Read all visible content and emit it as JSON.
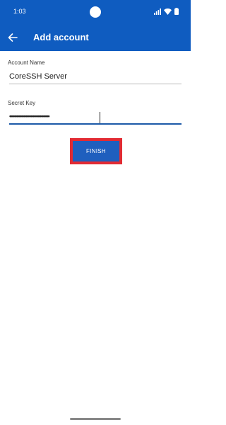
{
  "status_bar": {
    "time": "1:03"
  },
  "app_bar": {
    "title": "Add account",
    "back_icon": "arrow-left-icon"
  },
  "form": {
    "account_name": {
      "label": "Account Name",
      "value": "CoreSSH Server"
    },
    "secret_key": {
      "label": "Secret Key",
      "value": "••••••••••••••••••••••••••••••••••"
    }
  },
  "finish_button": {
    "label": "FINISH",
    "highlight_color": "#e22b33"
  },
  "colors": {
    "primary": "#0f5cc0",
    "button": "#1f5fbe",
    "underline_active": "#1d5aa8"
  }
}
